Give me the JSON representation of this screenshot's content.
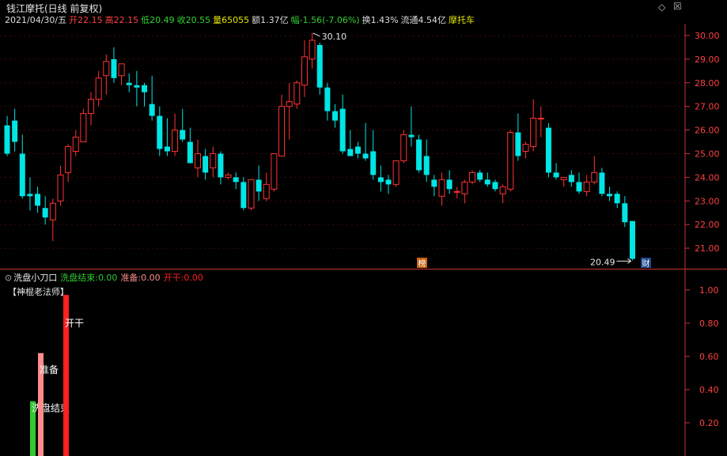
{
  "window": {
    "title": "钱江摩托(日线 前复权)"
  },
  "infobar": {
    "date": "2021/04/30/五",
    "open_label": "开",
    "open": "22.15",
    "high_label": "高",
    "high": "22.15",
    "low_label": "低",
    "low": "20.49",
    "close_label": "收",
    "close": "20.55",
    "volume_label": "量",
    "volume": "65055",
    "amount_label": "额",
    "amount": "1.37亿",
    "change_label": "幅",
    "change": "-1.56(-7.06%)",
    "turnover_label": "换",
    "turnover": "1.43%",
    "float_label": "流通",
    "float": "4.54亿",
    "concept": "摩托车"
  },
  "controls": {
    "diamond": "◇",
    "close": "☒"
  },
  "colors": {
    "up": "#ff3232",
    "down": "#00e5e5",
    "axis": "#c83232",
    "label_red": "#ff4040",
    "label_cyan": "#00d8d8",
    "label_green": "#32c832",
    "bar_pink": "#ff8c8c",
    "bar_red": "#ff2020"
  },
  "main_chart": {
    "y_ticks": [
      "30.00",
      "29.00",
      "28.00",
      "27.00",
      "26.00",
      "25.00",
      "24.00",
      "23.00",
      "22.00",
      "21.00"
    ],
    "y_tick_values": [
      30,
      29,
      28,
      27,
      26,
      25,
      24,
      23,
      22,
      21
    ],
    "y_min": 20.3,
    "y_max": 30.5,
    "high_marker": "30.10",
    "low_marker": "20.49",
    "badge_bang": "榜",
    "badge_cai": "财"
  },
  "indicator": {
    "name": "洗盘小刀口",
    "item1_label": "洗盘结束:",
    "item1_value": "0.00",
    "item2_label": "准备:",
    "item2_value": "0.00",
    "item3_label": "开干:",
    "item3_value": "0.00",
    "watermark": "【神棍老法师】",
    "y_ticks": [
      "1.00",
      "0.80",
      "0.60",
      "0.40",
      "0.20"
    ],
    "y_tick_values": [
      1.0,
      0.8,
      0.6,
      0.4,
      0.2
    ],
    "y_min": 0,
    "y_max": 1.09,
    "bars": [
      {
        "label": "洗盘结束",
        "value": 0.33,
        "color": "#32c832"
      },
      {
        "label": "准备",
        "value": 0.62,
        "color": "#ff8c8c"
      },
      {
        "label": "开干",
        "value": 0.97,
        "color": "#ff2020"
      }
    ]
  },
  "candles": [
    [
      26.2,
      26.6,
      24.9,
      25.0
    ],
    [
      26.4,
      26.9,
      25.1,
      25.5
    ],
    [
      25.0,
      25.8,
      23.1,
      23.2
    ],
    [
      23.3,
      24.0,
      22.6,
      23.2
    ],
    [
      23.3,
      23.6,
      22.5,
      22.8
    ],
    [
      22.7,
      23.2,
      22.0,
      22.3
    ],
    [
      22.2,
      23.1,
      21.3,
      22.9
    ],
    [
      23.0,
      24.5,
      22.8,
      24.1
    ],
    [
      24.2,
      25.4,
      23.8,
      25.3
    ],
    [
      25.1,
      26.0,
      24.9,
      25.7
    ],
    [
      25.5,
      26.9,
      25.5,
      26.7
    ],
    [
      26.7,
      27.6,
      26.2,
      27.3
    ],
    [
      27.3,
      28.5,
      27.0,
      28.2
    ],
    [
      28.3,
      29.2,
      27.5,
      28.9
    ],
    [
      29.0,
      29.5,
      28.0,
      28.2
    ],
    [
      28.3,
      28.8,
      27.9,
      28.8
    ],
    [
      28.0,
      28.4,
      27.6,
      27.9
    ],
    [
      27.9,
      28.5,
      27.0,
      27.8
    ],
    [
      27.9,
      28.0,
      27.0,
      27.6
    ],
    [
      27.1,
      28.3,
      26.4,
      26.6
    ],
    [
      26.6,
      27.0,
      24.9,
      25.2
    ],
    [
      25.3,
      26.5,
      24.9,
      25.1
    ],
    [
      25.1,
      26.7,
      24.9,
      26.0
    ],
    [
      26.0,
      26.9,
      25.5,
      25.6
    ],
    [
      25.5,
      26.1,
      24.6,
      24.6
    ],
    [
      24.4,
      25.6,
      24.0,
      25.0
    ],
    [
      24.9,
      25.2,
      23.9,
      24.2
    ],
    [
      24.4,
      25.3,
      24.0,
      25.0
    ],
    [
      25.0,
      25.1,
      23.7,
      24.0
    ],
    [
      24.0,
      24.2,
      23.9,
      24.1
    ],
    [
      24.0,
      24.2,
      23.5,
      23.8
    ],
    [
      23.8,
      24.0,
      22.6,
      22.7
    ],
    [
      22.7,
      23.9,
      22.6,
      23.9
    ],
    [
      23.9,
      24.5,
      23.0,
      23.4
    ],
    [
      23.1,
      24.2,
      23.0,
      23.7
    ],
    [
      23.5,
      25.0,
      23.4,
      25.0
    ],
    [
      24.9,
      27.5,
      24.9,
      27.0
    ],
    [
      27.0,
      28.0,
      25.6,
      27.2
    ],
    [
      27.1,
      28.1,
      26.9,
      28.0
    ],
    [
      27.9,
      29.8,
      27.4,
      29.1
    ],
    [
      29.0,
      30.1,
      28.6,
      29.8
    ],
    [
      29.6,
      29.7,
      27.5,
      27.8
    ],
    [
      27.8,
      28.0,
      26.4,
      26.8
    ],
    [
      26.8,
      27.1,
      26.1,
      26.4
    ],
    [
      26.9,
      27.5,
      25.0,
      25.1
    ],
    [
      25.2,
      26.0,
      24.9,
      24.9
    ],
    [
      25.3,
      25.5,
      24.8,
      25.0
    ],
    [
      25.0,
      26.3,
      24.7,
      24.8
    ],
    [
      25.1,
      26.0,
      23.9,
      24.1
    ],
    [
      24.0,
      24.5,
      23.4,
      23.8
    ],
    [
      23.9,
      24.1,
      23.3,
      23.7
    ],
    [
      23.7,
      24.6,
      23.6,
      24.7
    ],
    [
      24.7,
      26.0,
      24.6,
      25.8
    ],
    [
      25.8,
      27.0,
      25.3,
      25.7
    ],
    [
      25.6,
      25.8,
      24.2,
      24.3
    ],
    [
      24.9,
      25.6,
      23.8,
      24.1
    ],
    [
      23.9,
      24.1,
      23.2,
      23.6
    ],
    [
      23.2,
      24.2,
      22.8,
      23.9
    ],
    [
      23.9,
      24.3,
      23.3,
      23.5
    ],
    [
      23.4,
      23.6,
      23.1,
      23.4
    ],
    [
      23.3,
      23.9,
      22.9,
      23.8
    ],
    [
      23.8,
      24.3,
      23.7,
      24.2
    ],
    [
      24.2,
      24.3,
      23.8,
      23.9
    ],
    [
      23.9,
      24.2,
      23.6,
      23.7
    ],
    [
      23.8,
      23.9,
      23.4,
      23.5
    ],
    [
      23.3,
      23.7,
      22.9,
      23.6
    ],
    [
      23.5,
      26.0,
      23.4,
      25.9
    ],
    [
      25.9,
      26.7,
      24.7,
      24.9
    ],
    [
      25.1,
      25.5,
      24.8,
      25.4
    ],
    [
      25.3,
      27.3,
      25.1,
      26.5
    ],
    [
      26.5,
      27.0,
      25.7,
      26.5
    ],
    [
      26.1,
      26.3,
      24.0,
      24.2
    ],
    [
      24.2,
      24.6,
      23.9,
      24.0
    ],
    [
      23.9,
      24.0,
      23.6,
      24.0
    ],
    [
      24.1,
      24.3,
      23.6,
      23.8
    ],
    [
      23.8,
      24.2,
      23.3,
      23.4
    ],
    [
      23.4,
      24.1,
      23.2,
      23.8
    ],
    [
      23.8,
      24.9,
      23.7,
      24.2
    ],
    [
      24.2,
      24.4,
      23.2,
      23.3
    ],
    [
      23.3,
      23.6,
      23.0,
      23.2
    ],
    [
      23.3,
      23.4,
      22.7,
      22.9
    ],
    [
      22.9,
      23.2,
      21.9,
      22.1
    ],
    [
      22.15,
      22.15,
      20.49,
      20.55
    ]
  ]
}
